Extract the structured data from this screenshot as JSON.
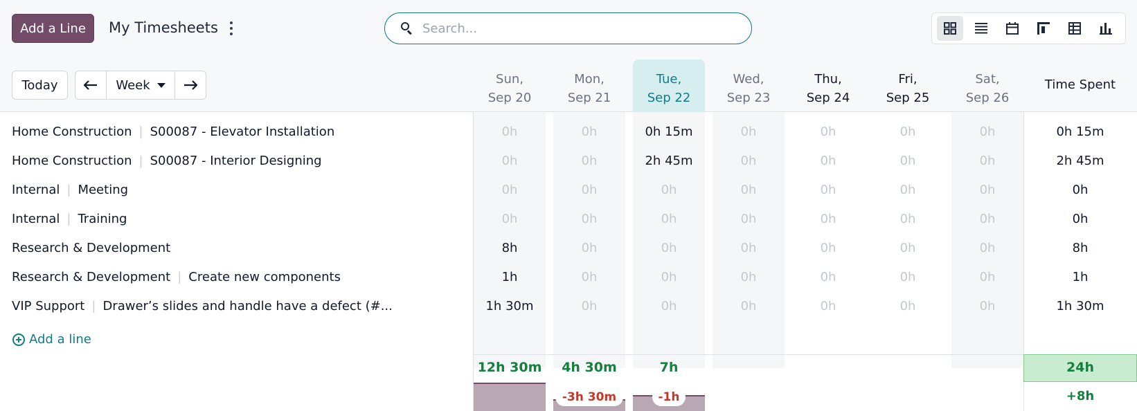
{
  "control_panel": {
    "add_button_label": "Add a Line",
    "title": "My Timesheets",
    "search_placeholder": "Search...",
    "views": [
      "grid-view-icon",
      "list-view-icon",
      "calendar-view-icon",
      "gantt-view-icon",
      "pivot-view-icon",
      "graph-view-icon"
    ],
    "active_view": "grid-view-icon"
  },
  "nav": {
    "today_label": "Today",
    "range_label": "Week"
  },
  "grid": {
    "days": [
      {
        "line1": "Sun,",
        "line2": "Sep 20",
        "style": "weekend"
      },
      {
        "line1": "Mon,",
        "line2": "Sep 21",
        "style": "muted"
      },
      {
        "line1": "Tue,",
        "line2": "Sep 22",
        "style": "today"
      },
      {
        "line1": "Wed,",
        "line2": "Sep 23",
        "style": "muted"
      },
      {
        "line1": "Thu,",
        "line2": "Sep 24",
        "style": "bold"
      },
      {
        "line1": "Fri,",
        "line2": "Sep 25",
        "style": "bold"
      },
      {
        "line1": "Sat,",
        "line2": "Sep 26",
        "style": "weekend"
      }
    ],
    "time_spent_header": "Time Spent",
    "rows": [
      {
        "project": "Home Construction",
        "task": "S00087 - Elevator Installation",
        "cells": [
          "0h",
          "0h",
          "0h 15m",
          "0h",
          "0h",
          "0h",
          "0h"
        ],
        "total": "0h 15m"
      },
      {
        "project": "Home Construction",
        "task": "S00087 - Interior Designing",
        "cells": [
          "0h",
          "0h",
          "2h 45m",
          "0h",
          "0h",
          "0h",
          "0h"
        ],
        "total": "2h 45m"
      },
      {
        "project": "Internal",
        "task": "Meeting",
        "cells": [
          "0h",
          "0h",
          "0h",
          "0h",
          "0h",
          "0h",
          "0h"
        ],
        "total": "0h"
      },
      {
        "project": "Internal",
        "task": "Training",
        "cells": [
          "0h",
          "0h",
          "0h",
          "0h",
          "0h",
          "0h",
          "0h"
        ],
        "total": "0h"
      },
      {
        "project": "Research & Development",
        "task": "",
        "cells": [
          "8h",
          "0h",
          "0h",
          "0h",
          "0h",
          "0h",
          "0h"
        ],
        "total": "8h"
      },
      {
        "project": "Research & Development",
        "task": "Create new components",
        "cells": [
          "1h",
          "0h",
          "0h",
          "0h",
          "0h",
          "0h",
          "0h"
        ],
        "total": "1h"
      },
      {
        "project": "VIP Support",
        "task": "Drawer’s slides and handle have a defect (#...",
        "cells": [
          "1h 30m",
          "0h",
          "0h",
          "0h",
          "0h",
          "0h",
          "0h"
        ],
        "total": "1h 30m"
      }
    ],
    "add_line_label": "Add a line"
  },
  "totals": {
    "day_totals": [
      "12h 30m",
      "4h 30m",
      "7h",
      "",
      "",
      "",
      ""
    ],
    "differences": [
      "",
      "-3h 30m",
      "-1h",
      "",
      "",
      "",
      ""
    ],
    "grand_total": "24h",
    "overtime": "+8h"
  },
  "colors": {
    "primary": "#714b67",
    "accent": "#0f7c86",
    "success": "#15803d",
    "danger": "#c0392b"
  }
}
